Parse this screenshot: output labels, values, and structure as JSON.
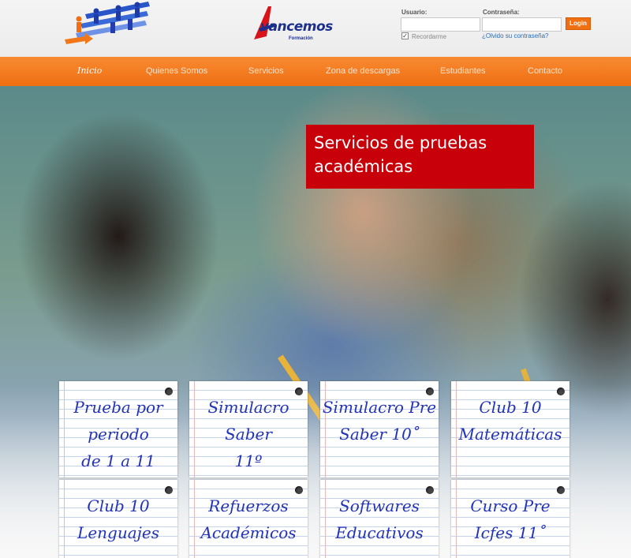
{
  "header": {
    "logo_text": "vancemos",
    "logo_sub": "Formación"
  },
  "login": {
    "user_label": "Usuario:",
    "user_value": "",
    "pass_label": "Contraseña:",
    "pass_value": "",
    "login_label": "Login",
    "remember_label": "Recordarme",
    "remember_checked": "✓",
    "forgot_label": "¿Olvido su contraseña?"
  },
  "nav": {
    "items": [
      {
        "label": "Inicio"
      },
      {
        "label": "Quienes Somos"
      },
      {
        "label": "Servicios"
      },
      {
        "label": "Zona de descargas"
      },
      {
        "label": "Estudiantes"
      },
      {
        "label": "Contacto"
      }
    ]
  },
  "hero": {
    "banner_line1": "Servicios de pruebas",
    "banner_line2": "académicas"
  },
  "notes": [
    {
      "lines": [
        "Prueba por",
        "periodo",
        "de 1 a 11"
      ]
    },
    {
      "lines": [
        "Simulacro Saber",
        "11º"
      ]
    },
    {
      "lines": [
        "Simulacro Pre",
        "Saber 10˚"
      ]
    },
    {
      "lines": [
        "Club 10",
        "Matemáticas"
      ]
    },
    {
      "lines": [
        "Club 10",
        "Lenguajes"
      ]
    },
    {
      "lines": [
        "Refuerzos",
        "Académicos"
      ]
    },
    {
      "lines": [
        "Softwares",
        "Educativos"
      ]
    },
    {
      "lines": [
        "Curso Pre",
        "Icfes 11˚"
      ]
    }
  ],
  "colors": {
    "nav_orange": "#f06f12",
    "banner_red": "#c8000a",
    "note_ink": "#2233b5",
    "logo_blue": "#1c2f8c"
  }
}
